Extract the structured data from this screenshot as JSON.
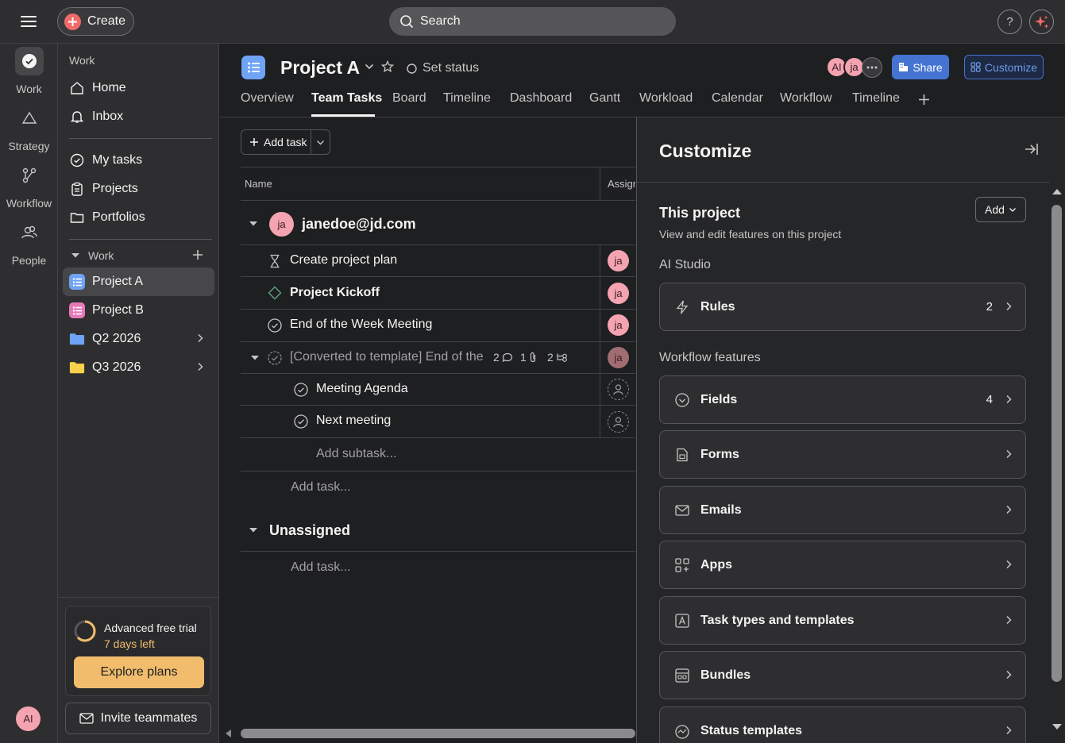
{
  "topbar": {
    "create_label": "Create",
    "search_label": "Search",
    "help_label": "?"
  },
  "rail": {
    "items": [
      {
        "label": "Work",
        "icon": "check-circle-icon"
      },
      {
        "label": "Strategy",
        "icon": "triangle-icon"
      },
      {
        "label": "Workflow",
        "icon": "workflow-icon"
      },
      {
        "label": "People",
        "icon": "people-icon"
      }
    ],
    "avatar": "AI"
  },
  "sidebar": {
    "heading": "Work",
    "nav": [
      {
        "label": "Home",
        "icon": "home-icon"
      },
      {
        "label": "Inbox",
        "icon": "bell-icon"
      }
    ],
    "nav2": [
      {
        "label": "My tasks",
        "icon": "check-circle-icon"
      },
      {
        "label": "Projects",
        "icon": "clipboard-icon"
      },
      {
        "label": "Portfolios",
        "icon": "folder-icon"
      }
    ],
    "work_section": "Work",
    "projects": [
      {
        "label": "Project A",
        "color": "#6ea3f5"
      },
      {
        "label": "Project B",
        "color": "#e879b9"
      },
      {
        "label": "Q2 2026",
        "color": "#6ea3f5"
      },
      {
        "label": "Q3 2026",
        "color": "#f8d04c"
      }
    ],
    "trial": {
      "title": "Advanced free trial",
      "days_left": "7 days left",
      "explore": "Explore plans"
    },
    "invite": "Invite teammates"
  },
  "project": {
    "title": "Project A",
    "set_status": "Set status",
    "avatars": [
      "AI",
      "ja"
    ],
    "share": "Share",
    "customize": "Customize",
    "tabs": [
      "Overview",
      "Team Tasks",
      "Board",
      "Timeline",
      "Dashboard",
      "Gantt",
      "Workload",
      "Calendar",
      "Workflow",
      "Timeline"
    ],
    "active_tab": "Team Tasks"
  },
  "tasks": {
    "add_task": "Add task",
    "col_name": "Name",
    "col_assignee": "Assign",
    "sections": [
      {
        "title": "janedoe@jd.com",
        "avatar": "ja",
        "rows": [
          {
            "name": "Create project plan",
            "icon": "hourglass-icon",
            "assignee": "ja",
            "bold": false
          },
          {
            "name": "Project Kickoff",
            "icon": "diamond-icon",
            "assignee": "ja",
            "bold": true
          },
          {
            "name": "End of the Week Meeting",
            "icon": "check-circle-icon",
            "assignee": "ja",
            "bold": false
          },
          {
            "name": "[Converted to template] End of the",
            "icon": "check-circle-icon",
            "assignee": "ja",
            "comments": "2",
            "attachments": "1",
            "subtasks": "2",
            "muted": true
          }
        ],
        "subtasks": [
          {
            "name": "Meeting Agenda"
          },
          {
            "name": "Next meeting"
          }
        ],
        "add_subtask": "Add subtask...",
        "add_task": "Add task..."
      },
      {
        "title": "Unassigned",
        "add_task": "Add task..."
      }
    ]
  },
  "customize_panel": {
    "title": "Customize",
    "section_title": "This project",
    "section_sub": "View and edit features on this project",
    "add": "Add",
    "ai_studio_label": "AI Studio",
    "rules": {
      "label": "Rules",
      "count": "2"
    },
    "workflow_label": "Workflow features",
    "features": [
      {
        "label": "Fields",
        "count": "4",
        "icon": "fields-icon"
      },
      {
        "label": "Forms",
        "count": "",
        "icon": "form-icon"
      },
      {
        "label": "Emails",
        "count": "",
        "icon": "mail-icon"
      },
      {
        "label": "Apps",
        "count": "",
        "icon": "apps-icon"
      },
      {
        "label": "Task types and templates",
        "count": "",
        "icon": "template-icon"
      },
      {
        "label": "Bundles",
        "count": "",
        "icon": "bundle-icon"
      },
      {
        "label": "Status templates",
        "count": "",
        "icon": "status-icon"
      }
    ]
  }
}
